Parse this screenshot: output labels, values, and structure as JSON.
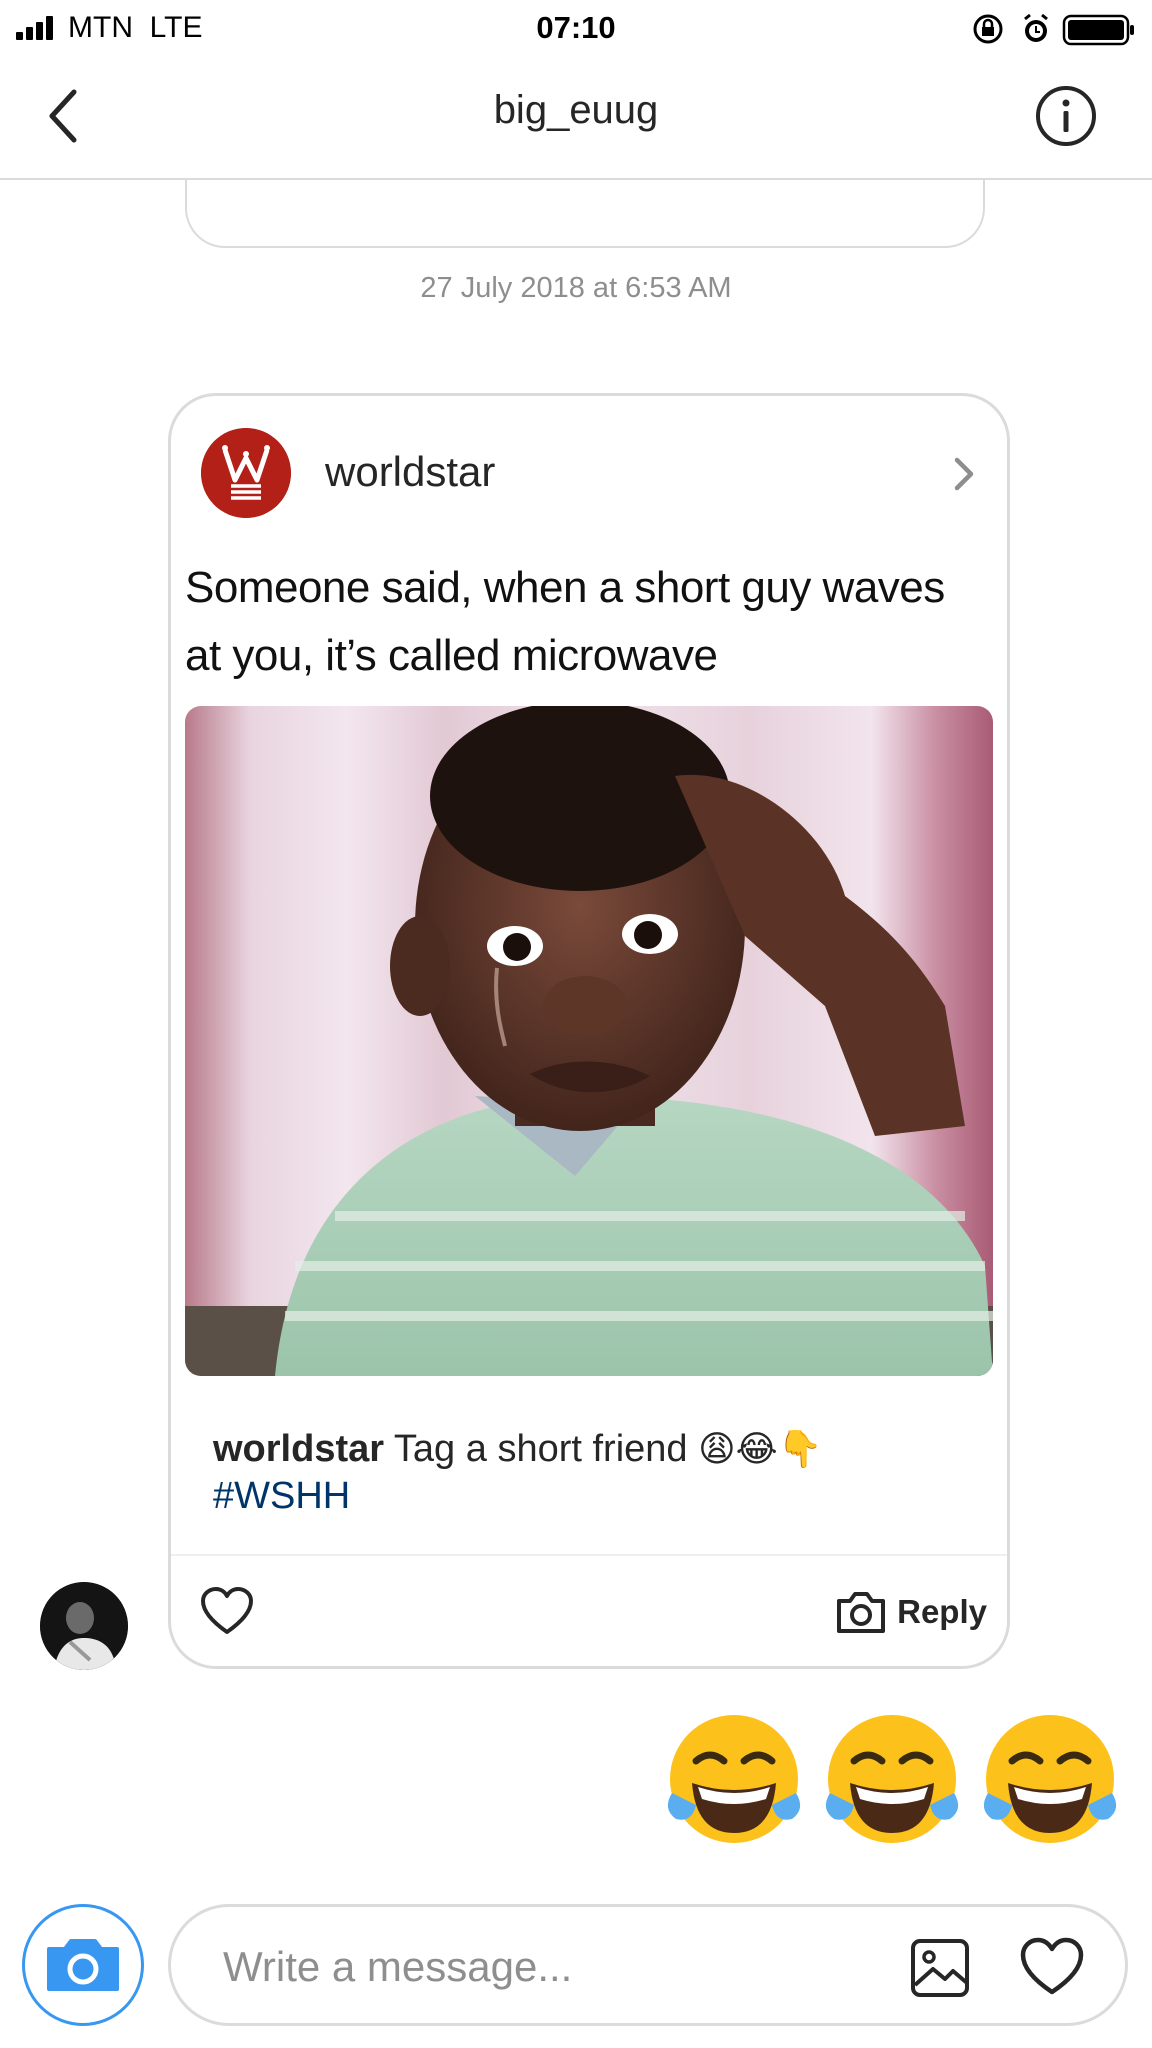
{
  "status_bar": {
    "carrier": "MTN",
    "network": "LTE",
    "time": "07:10"
  },
  "nav": {
    "title": "big_euug",
    "back_icon": "chevron-left-icon",
    "info_icon": "info-icon"
  },
  "thread": {
    "timestamp": "27 July 2018 at 6:53 AM"
  },
  "shared_post": {
    "username": "worldstar",
    "avatar_icon": "worldstar-logo",
    "meme_text_line1": "Someone said, when a short guy waves",
    "meme_text_line2": "at you, it’s called microwave",
    "caption_user": "worldstar",
    "caption_text": "Tag a short friend",
    "caption_emojis": "😩😂👇",
    "caption_hashtag": "#WSHH",
    "reply_label": "Reply",
    "brand_color": "#b22018",
    "hashtag_color": "#003569"
  },
  "emoji_message": {
    "emojis": [
      "😂",
      "😂",
      "😂"
    ]
  },
  "composer": {
    "placeholder": "Write a message...",
    "value": "",
    "accent_color": "#3897f0"
  }
}
